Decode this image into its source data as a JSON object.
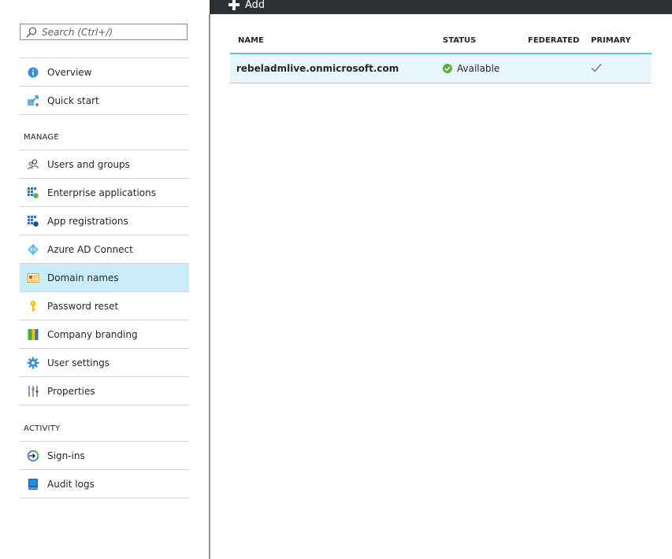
{
  "toolbar": {
    "add_label": "Add"
  },
  "search": {
    "placeholder": "Search (Ctrl+/)"
  },
  "menu": {
    "top_items": [
      {
        "label": "Overview",
        "icon": "info-icon"
      },
      {
        "label": "Quick start",
        "icon": "quickstart-icon"
      }
    ],
    "manage_header": "MANAGE",
    "manage_items": [
      {
        "label": "Users and groups",
        "icon": "users-icon"
      },
      {
        "label": "Enterprise applications",
        "icon": "enterprise-apps-icon"
      },
      {
        "label": "App registrations",
        "icon": "app-registrations-icon"
      },
      {
        "label": "Azure AD Connect",
        "icon": "ad-connect-icon"
      },
      {
        "label": "Domain names",
        "icon": "domain-names-icon",
        "selected": true
      },
      {
        "label": "Password reset",
        "icon": "key-icon"
      },
      {
        "label": "Company branding",
        "icon": "branding-icon"
      },
      {
        "label": "User settings",
        "icon": "gear-icon"
      },
      {
        "label": "Properties",
        "icon": "sliders-icon"
      }
    ],
    "activity_header": "ACTIVITY",
    "activity_items": [
      {
        "label": "Sign-ins",
        "icon": "signin-icon"
      },
      {
        "label": "Audit logs",
        "icon": "book-icon"
      }
    ]
  },
  "grid": {
    "columns": {
      "name": "NAME",
      "status": "STATUS",
      "federated": "FEDERATED",
      "primary": "PRIMARY"
    },
    "rows": [
      {
        "name": "rebeladmlive.onmicrosoft.com",
        "status": "Available",
        "federated": "",
        "primary": true
      }
    ]
  },
  "colors": {
    "accent": "#5fc2dd",
    "selected": "#c8ecf9",
    "topbar": "#2b3035",
    "status_ok": "#59b03a"
  }
}
